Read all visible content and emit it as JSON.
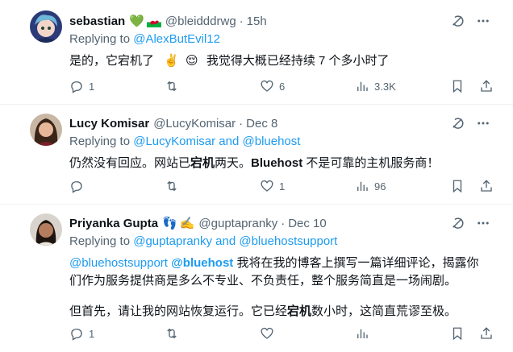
{
  "tweets": [
    {
      "name": "sebastian",
      "badges": [
        "💚",
        "🏴"
      ],
      "handle": "@bleidddrwg",
      "time": "15h",
      "replying_prefix": "Replying to ",
      "replying_to": "@AlexButEvil12",
      "text_a": "是的，它宕机了",
      "emoji_a": "✌️",
      "emoji_b": "😌",
      "text_b": "我觉得大概已经持续 7 个多小时了",
      "replies": "1",
      "retweets": "",
      "likes": "6",
      "views": "3.3K"
    },
    {
      "name": "Lucy Komisar",
      "handle": "@LucyKomisar",
      "time": "Dec 8",
      "replying_prefix": "Replying to ",
      "replying_to": "@LucyKomisar and @bluehost",
      "text_1": "仍然没有回应。网站已",
      "text_2": "宕机",
      "text_3": "两天。",
      "text_4": "Bluehost",
      "text_5": " 不是可靠的主机服务商！",
      "replies": "",
      "retweets": "",
      "likes": "1",
      "views": "96"
    },
    {
      "name": "Priyanka Gupta",
      "badges": [
        "👣",
        "✍️"
      ],
      "handle": "@guptapranky",
      "time": "Dec 10",
      "replying_prefix": "Replying to ",
      "replying_to": "@guptapranky and @bluehostsupport",
      "mention_1": "@bluehostsupport",
      "mention_2": "@bluehost",
      "para_1": " 我将在我的博客上撰写一篇详细评论，揭露你们作为服务提供商是多么不专业、不负责任，整个服务简直是一场闹剧。",
      "para_2a": "但首先，请让我的网站恢复运行。它已经",
      "para_2b": "宕机",
      "para_2c": "数小时，这简直荒谬至极。",
      "replies": "1",
      "retweets": "",
      "likes": "",
      "views": ""
    }
  ],
  "icons": {
    "grok": "grok-icon",
    "more": "more-icon",
    "reply": "reply-icon",
    "retweet": "retweet-icon",
    "like": "like-icon",
    "views": "views-icon",
    "bookmark": "bookmark-icon",
    "share": "share-icon"
  },
  "colors": {
    "link": "#1d9bf0",
    "secondary": "#536471",
    "text": "#0f1419",
    "divider": "#eff3f4"
  }
}
